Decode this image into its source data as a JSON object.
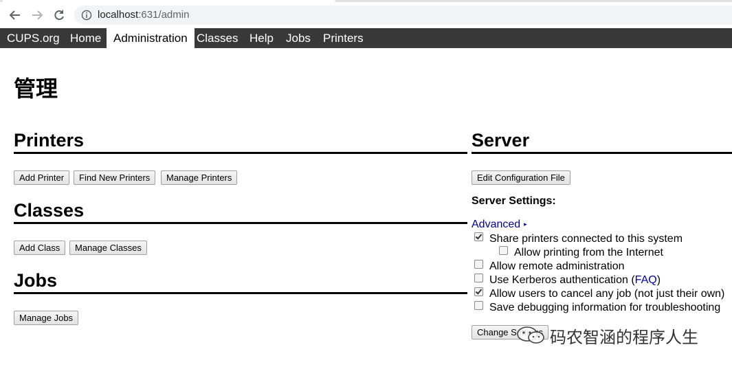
{
  "browser": {
    "url_host": "localhost",
    "url_path": ":631/admin"
  },
  "nav": {
    "items": [
      {
        "label": "CUPS.org"
      },
      {
        "label": "Home"
      },
      {
        "label": "Administration",
        "active": true
      },
      {
        "label": "Classes"
      },
      {
        "label": "Help"
      },
      {
        "label": "Jobs"
      },
      {
        "label": "Printers"
      }
    ]
  },
  "page": {
    "title": "管理"
  },
  "printers": {
    "heading": "Printers",
    "add_printer": "Add Printer",
    "find_new_printers": "Find New Printers",
    "manage_printers": "Manage Printers"
  },
  "classes": {
    "heading": "Classes",
    "add_class": "Add Class",
    "manage_classes": "Manage Classes"
  },
  "jobs": {
    "heading": "Jobs",
    "manage_jobs": "Manage Jobs"
  },
  "server": {
    "heading": "Server",
    "edit_config": "Edit Configuration File",
    "settings_heading": "Server Settings:",
    "advanced": "Advanced",
    "options": [
      {
        "label": "Share printers connected to this system",
        "checked": true
      },
      {
        "label": "Allow printing from the Internet",
        "checked": false
      },
      {
        "label": "Allow remote administration",
        "checked": false
      },
      {
        "label": "Use Kerberos authentication (",
        "link": "FAQ",
        "suffix": ")",
        "checked": false
      },
      {
        "label": "Allow users to cancel any job (not just their own)",
        "checked": true
      },
      {
        "label": "Save debugging information for troubleshooting",
        "checked": false
      }
    ],
    "change_settings": "Change Settings"
  },
  "watermark": {
    "text": "码农智涵的程序人生"
  },
  "colors": {
    "nav_bg": "#393939",
    "link": "#000099"
  }
}
